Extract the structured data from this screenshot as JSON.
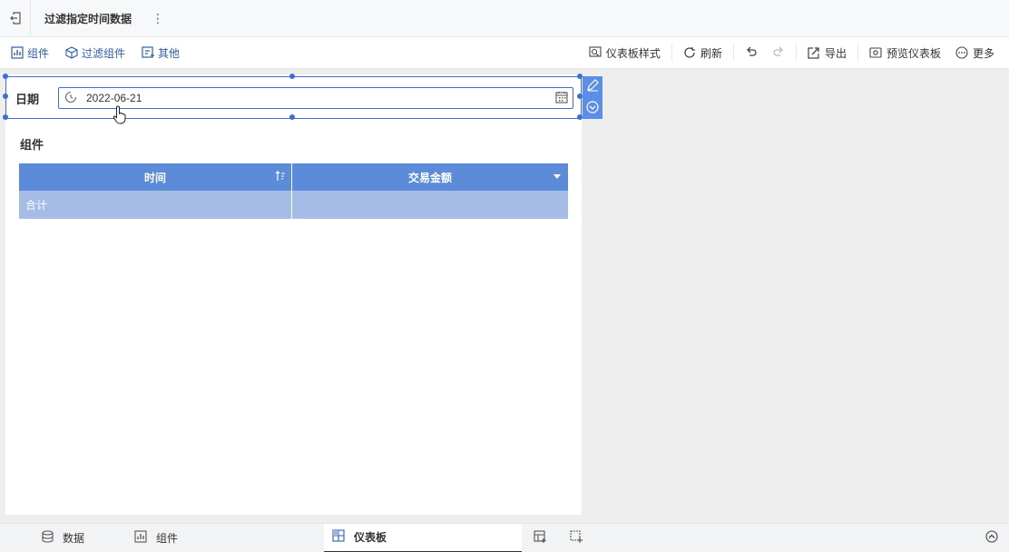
{
  "title": {
    "exit_icon": "exit-icon",
    "doc_name": "过滤指定时间数据",
    "more_icon": "more-vertical-icon"
  },
  "toolbar": {
    "left": [
      {
        "label": "组件",
        "icon": "chart-add-icon"
      },
      {
        "label": "过滤组件",
        "icon": "filter-cube-icon"
      },
      {
        "label": "其他",
        "icon": "other-add-icon"
      }
    ],
    "style_label": "仪表板样式",
    "refresh_label": "刷新",
    "export_label": "导出",
    "preview_label": "预览仪表板",
    "more_label": "更多"
  },
  "filter": {
    "label": "日期",
    "value": "2022-06-21"
  },
  "component": {
    "title": "组件",
    "columns": [
      "时间",
      "交易金额"
    ],
    "total_label": "合计"
  },
  "bottom": {
    "tabs": [
      {
        "label": "数据",
        "icon": "database-icon"
      },
      {
        "label": "组件",
        "icon": "chart-icon"
      },
      {
        "label": "仪表板",
        "icon": "dashboard-icon"
      }
    ],
    "active_tab": "仪表板"
  },
  "colors": {
    "accent": "#3a6fd8",
    "header": "#5b8bd9",
    "total_row": "#a5bce6"
  }
}
